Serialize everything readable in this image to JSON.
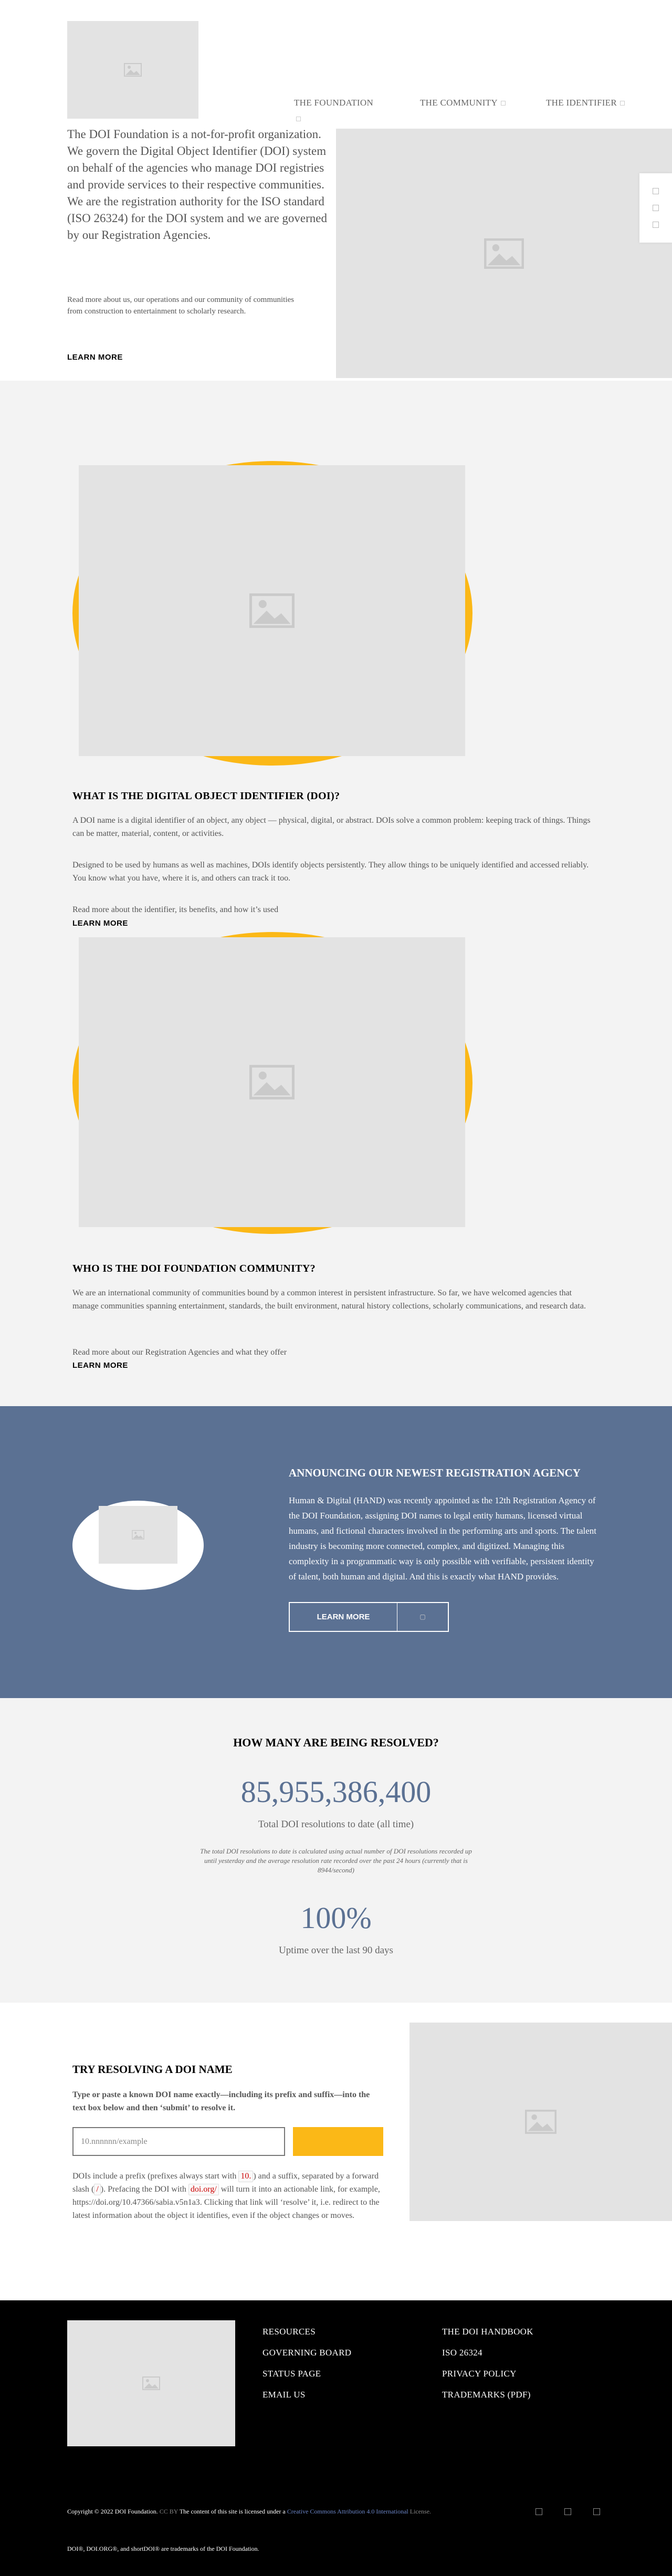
{
  "nav": {
    "items": [
      {
        "label": "THE FOUNDATION"
      },
      {
        "label": "THE COMMUNITY"
      },
      {
        "label": "THE IDENTIFIER"
      }
    ]
  },
  "intro": {
    "text": "The DOI Foundation is a not-for-profit organization. We govern the Digital Object Identifier (DOI) system on behalf of the agencies who manage DOI registries and provide services to their respective communities. We are the registration authority for the ISO standard (ISO 26324) for the DOI system and we are governed by our Registration Agencies.",
    "more": "Read more about us, our operations and our community of communities from construction to entertainment to scholarly research.",
    "learn_more": "LEARN MORE"
  },
  "identifier": {
    "title": "WHAT IS THE DIGITAL OBJECT IDENTIFIER (DOI)?",
    "p1": "A DOI name is a digital identifier of an object, any object — physical, digital, or abstract. DOIs solve a common problem: keeping track of things. Things can be matter, material, content, or activities.",
    "p2": "Designed to be used by humans as well as machines, DOIs identify objects persistently. They allow things to be uniquely identified and accessed reliably. You know what you have, where it is, and others can track it too.",
    "more": "Read more about the identifier, its benefits, and how it’s used",
    "learn_more": "LEARN MORE"
  },
  "community": {
    "title": "WHO IS THE DOI FOUNDATION COMMUNITY?",
    "p1": "We are an international community of communities bound by a common interest in persistent infrastructure. So far, we have welcomed agencies that manage communities spanning entertainment, standards, the built environment, natural history collections, scholarly communications, and research data.",
    "more": "Read more about our Registration Agencies and what they offer",
    "learn_more": "LEARN MORE"
  },
  "announcement": {
    "title": "ANNOUNCING OUR NEWEST REGISTRATION AGENCY",
    "text": "Human & Digital (HAND) was recently appointed as the 12th Registration Agency of the DOI Foundation, assigning DOI names to legal entity humans, licensed virtual humans, and fictional characters involved in the performing arts and sports. The talent industry is becoming more connected, complex, and digitized. Managing this complexity in a programmatic way is only possible with verifiable, persistent identity of talent, both human and digital. And this is exactly what HAND provides.",
    "button": "LEARN MORE"
  },
  "stats": {
    "title": "HOW MANY ARE BEING RESOLVED?",
    "total": "85,955,386,400",
    "total_caption": "Total DOI resolutions to date (all time)",
    "note": "The total DOI resolutions to date is calculated using actual number of DOI resolutions recorded up until yesterday and the average resolution rate recorded over the past 24 hours (currently that is 8944/second)",
    "uptime": "100%",
    "uptime_caption": "Uptime over the last 90 days"
  },
  "resolver": {
    "title": "TRY RESOLVING A DOI NAME",
    "subtitle": "Type or paste a known DOI name exactly—including its prefix and suffix—into the text box below and then ‘submit’ to resolve it.",
    "placeholder": "10.nnnnnn/example",
    "desc_1": "DOIs include a prefix (prefixes always start with ",
    "code_prefix": "10.",
    "desc_2": ") and a suffix, separated by a forward slash (",
    "code_slash": "/",
    "desc_3": "). Prefacing the DOI with ",
    "code_doiorg": "doi.org/",
    "desc_4": " will turn it into an actionable link, for example, https://doi.org/10.47366/sabia.v5n1a3. Clicking that link will ‘resolve’ it, i.e. redirect to the latest information about the object it identifies, even if the object changes or moves."
  },
  "footer": {
    "col1": [
      "RESOURCES",
      "GOVERNING BOARD",
      "STATUS PAGE",
      "EMAIL US"
    ],
    "col2": [
      "THE DOI HANDBOOK",
      "ISO 26324",
      "PRIVACY POLICY",
      "TRADEMARKS (PDF)"
    ],
    "copyright": "Copyright © 2022 DOI Foundation.",
    "cc_short": "CC BY",
    "license_intro": "The content of this site is licensed under a",
    "license_link": "Creative Commons Attribution 4.0 International",
    "license_end": "License.",
    "trademark": "DOI®, DOI.ORG®, and shortDOI® are trademarks of the DOI Foundation."
  },
  "colors": {
    "accent_yellow": "#fbb817",
    "brand_blue": "#5b7193",
    "footer_bg": "#000000"
  }
}
